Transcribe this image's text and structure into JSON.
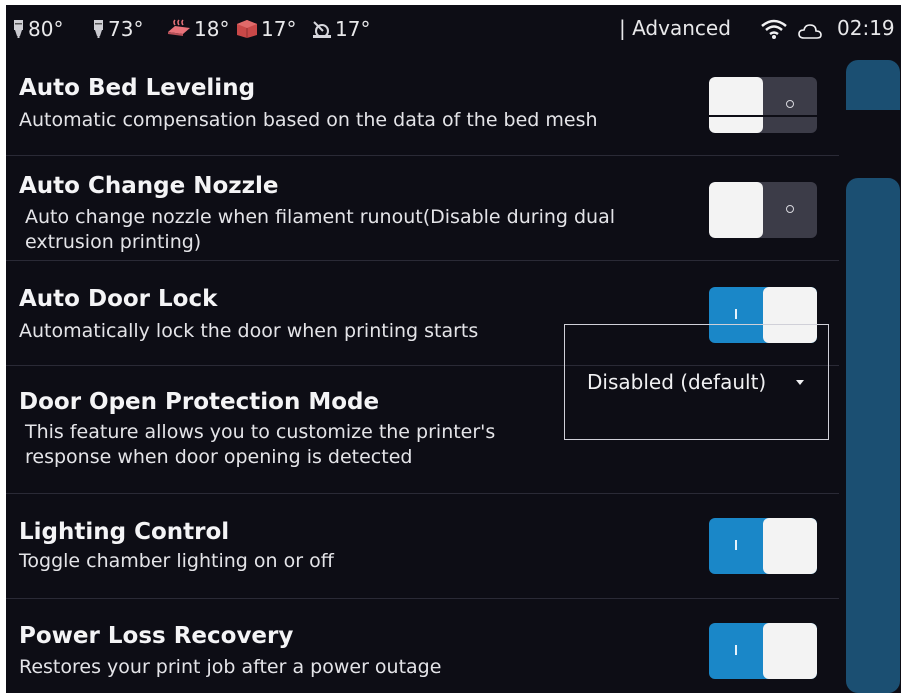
{
  "status_bar": {
    "temps": [
      {
        "icon": "nozzle-left-icon",
        "value": "80°"
      },
      {
        "icon": "nozzle-right-icon",
        "value": "73°"
      },
      {
        "icon": "heated-bed-icon",
        "value": "18°"
      },
      {
        "icon": "chamber-icon",
        "value": "17°"
      },
      {
        "icon": "mcu-temp-icon",
        "value": "17°"
      }
    ],
    "mode": "| Advanced",
    "wifi_icon": "wifi-icon",
    "cloud_icon": "cloud-icon",
    "time": "02:19"
  },
  "settings": [
    {
      "title": "Auto Bed Leveling",
      "description": "Automatic compensation based on the data of the bed mesh",
      "control": "toggle",
      "state": "off"
    },
    {
      "title": "Auto Change Nozzle",
      "description_lines": [
        "Auto change nozzle when filament runout(Disable during dual",
        "extrusion printing)"
      ],
      "control": "toggle",
      "state": "off"
    },
    {
      "title": "Auto Door Lock",
      "description": "Automatically lock the door when printing starts",
      "control": "toggle",
      "state": "on"
    },
    {
      "title": "Door Open Protection Mode",
      "description_lines": [
        "This feature allows you to customize the printer's",
        "response when door opening is detected"
      ],
      "control": "dropdown",
      "selected": "Disabled (default)"
    },
    {
      "title": "Lighting Control",
      "description": "Toggle chamber lighting on or off",
      "control": "toggle",
      "state": "on"
    },
    {
      "title": "Power Loss Recovery",
      "description": "Restores your print job after a power outage",
      "control": "toggle",
      "state": "on"
    }
  ],
  "colors": {
    "background": "#0d0d15",
    "toggle_on": "#1a87c8",
    "toggle_off": "#3c3c48",
    "scrollbar": "#1b4f72"
  }
}
